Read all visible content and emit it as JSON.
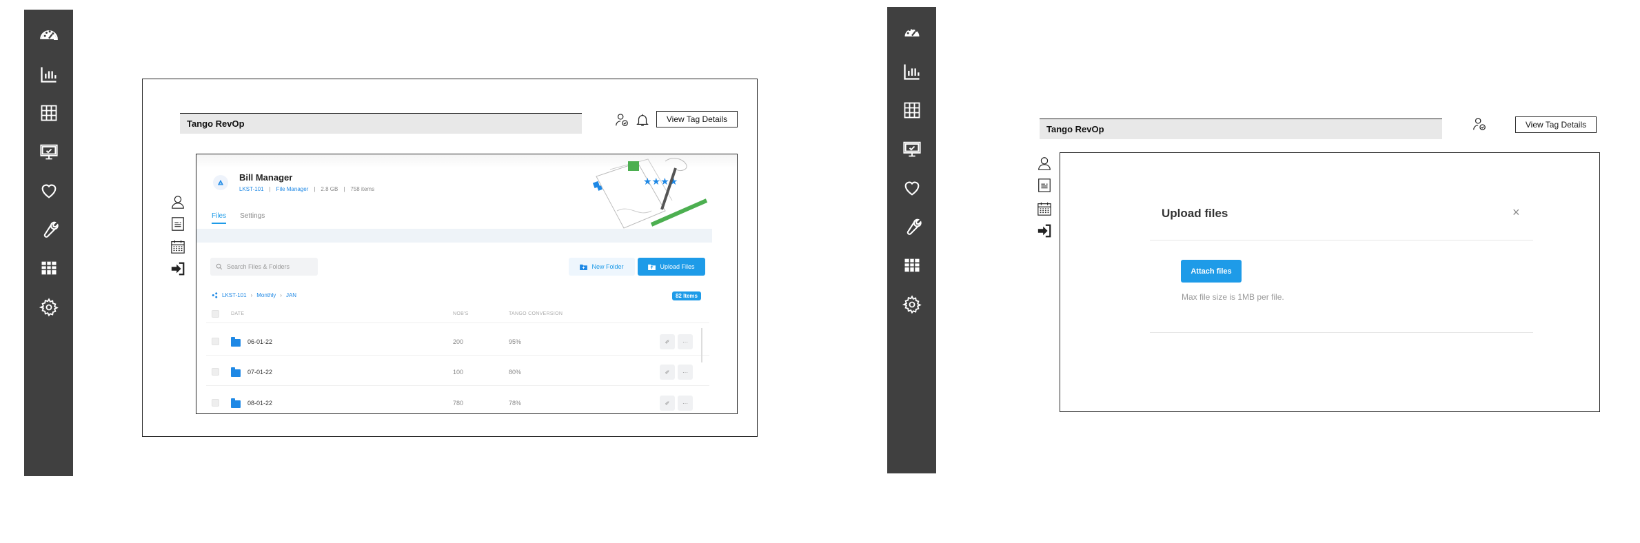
{
  "app": {
    "title": "Tango RevOp",
    "view_tag_label": "View Tag Details"
  },
  "sidebar": {
    "items": [
      {
        "icon": "dashboard-icon"
      },
      {
        "icon": "bar-chart-icon"
      },
      {
        "icon": "table-grid-icon"
      },
      {
        "icon": "monitor-check-icon"
      },
      {
        "icon": "heart-icon"
      },
      {
        "icon": "wrench-icon"
      },
      {
        "icon": "spreadsheet-icon"
      },
      {
        "icon": "gear-icon"
      }
    ]
  },
  "secondary_nav": [
    "user-icon",
    "document-icon",
    "calendar-icon",
    "sign-in-icon"
  ],
  "bill_manager": {
    "title": "Bill Manager",
    "meta": {
      "code": "LKST-101",
      "app": "File Manager",
      "size": "2.8 GB",
      "items": "758 items"
    },
    "tabs": [
      "Files",
      "Settings"
    ],
    "search_placeholder": "Search Files & Folders",
    "new_folder_label": "New Folder",
    "upload_label": "Upload Files",
    "breadcrumb": [
      "LKST-101",
      "Monthly",
      "JAN"
    ],
    "items_badge": "82 Items",
    "columns": [
      "DATE",
      "NOB'S",
      "TANGO CONVERSION"
    ],
    "rows": [
      {
        "date": "06-01-22",
        "nobs": "200",
        "conversion": "95%"
      },
      {
        "date": "07-01-22",
        "nobs": "100",
        "conversion": "80%"
      },
      {
        "date": "08-01-22",
        "nobs": "780",
        "conversion": "78%"
      }
    ],
    "action_more": "···",
    "action_edit": "✐"
  },
  "upload_dialog": {
    "title": "Upload files",
    "close": "×",
    "attach_label": "Attach files",
    "hint": "Max file size is 1MB per file."
  }
}
